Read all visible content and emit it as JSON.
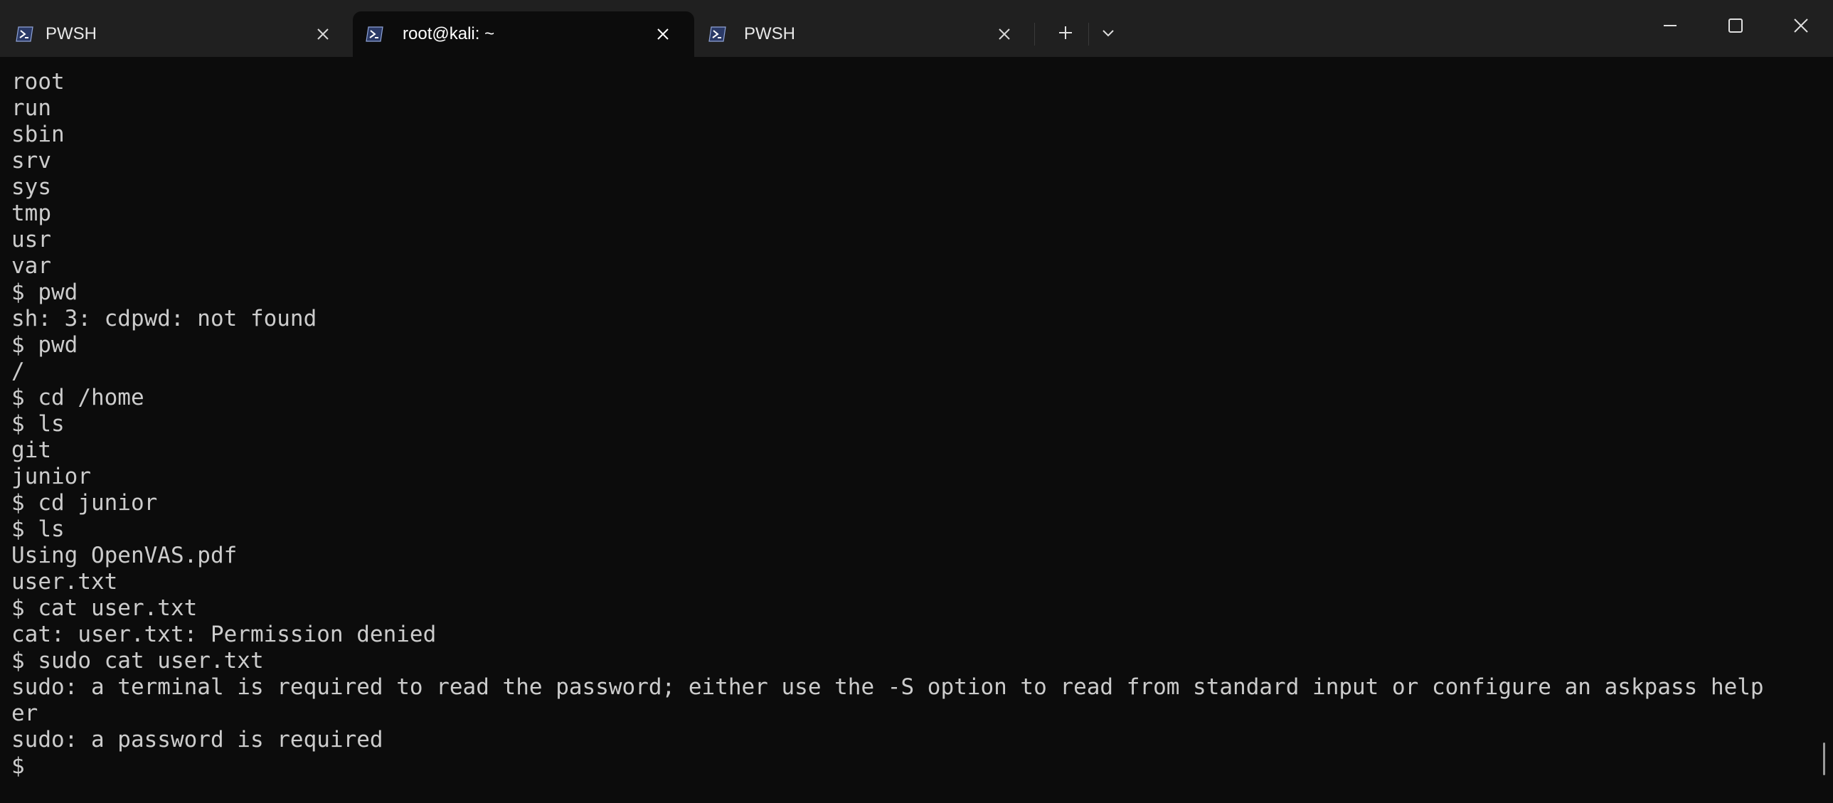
{
  "tabs": [
    {
      "label": "PWSH",
      "active": false
    },
    {
      "label": "root@kali: ~",
      "active": true
    },
    {
      "label": "PWSH",
      "active": false
    }
  ],
  "terminal": {
    "lines": [
      "root",
      "run",
      "sbin",
      "srv",
      "sys",
      "tmp",
      "usr",
      "var",
      "$ pwd",
      "sh: 3: cdpwd: not found",
      "$ pwd",
      "/",
      "$ cd /home",
      "$ ls",
      "git",
      "junior",
      "$ cd junior",
      "$ ls",
      "Using OpenVAS.pdf",
      "user.txt",
      "$ cat user.txt",
      "cat: user.txt: Permission denied",
      "$ sudo cat user.txt",
      "sudo: a terminal is required to read the password; either use the -S option to read from standard input or configure an askpass help",
      "er",
      "sudo: a password is required",
      "$"
    ]
  },
  "icons": {
    "tab_icon": "powershell-icon",
    "close": "close-icon",
    "new_tab": "plus-icon",
    "dropdown": "chevron-down-icon",
    "minimize": "minimize-icon",
    "maximize": "maximize-icon",
    "window_close": "window-close-icon"
  },
  "colors": {
    "titlebar_bg": "#202020",
    "terminal_bg": "#0c0c0c",
    "text": "#cccccc"
  }
}
